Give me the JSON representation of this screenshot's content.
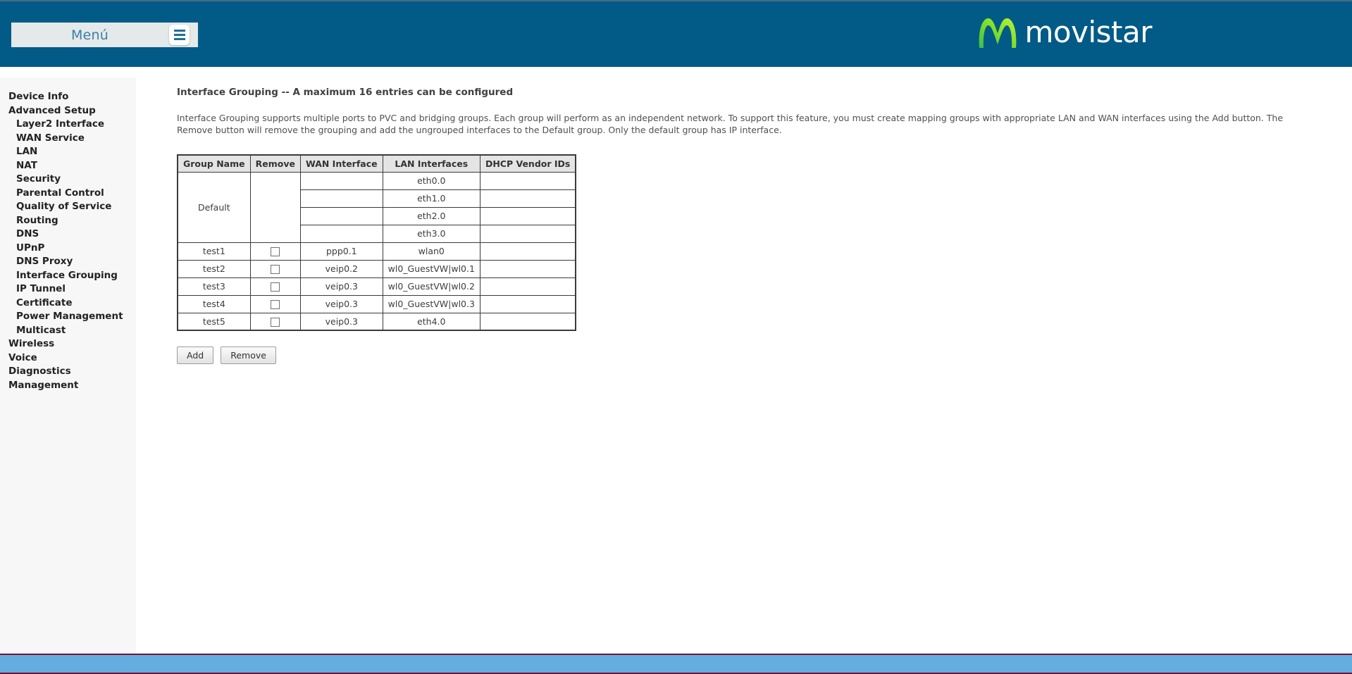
{
  "header": {
    "menu_label": "Menú",
    "menu_icon": "hamburger-icon",
    "brand": "movistar",
    "brand_mark_icon": "movistar-m-icon",
    "bar_color": "#025B87",
    "menu_box_color": "#e4e9ea",
    "menu_text_color": "#3c7fa8"
  },
  "sidebar": {
    "items": [
      {
        "label": "Device Info",
        "level": 0
      },
      {
        "label": "Advanced Setup",
        "level": 0
      },
      {
        "label": "Layer2 Interface",
        "level": 1
      },
      {
        "label": "WAN Service",
        "level": 1
      },
      {
        "label": "LAN",
        "level": 1
      },
      {
        "label": "NAT",
        "level": 1
      },
      {
        "label": "Security",
        "level": 1
      },
      {
        "label": "Parental Control",
        "level": 1
      },
      {
        "label": "Quality of Service",
        "level": 1
      },
      {
        "label": "Routing",
        "level": 1
      },
      {
        "label": "DNS",
        "level": 1
      },
      {
        "label": "UPnP",
        "level": 1
      },
      {
        "label": "DNS Proxy",
        "level": 1
      },
      {
        "label": "Interface Grouping",
        "level": 1
      },
      {
        "label": "IP Tunnel",
        "level": 1
      },
      {
        "label": "Certificate",
        "level": 1
      },
      {
        "label": "Power Management",
        "level": 1
      },
      {
        "label": "Multicast",
        "level": 1
      },
      {
        "label": "Wireless",
        "level": 0
      },
      {
        "label": "Voice",
        "level": 0
      },
      {
        "label": "Diagnostics",
        "level": 0
      },
      {
        "label": "Management",
        "level": 0
      }
    ],
    "background": "#f7f7f7"
  },
  "main": {
    "title": "Interface Grouping -- A maximum 16 entries can be configured",
    "description": "Interface Grouping supports multiple ports to PVC and bridging groups. Each group will perform as an independent network. To support this feature, you must create mapping groups with appropriate LAN and WAN interfaces using the Add button. The Remove button will remove the grouping and add the ungrouped interfaces to the Default group. Only the default group has IP interface.",
    "table": {
      "columns": [
        "Group Name",
        "Remove",
        "WAN Interface",
        "LAN Interfaces",
        "DHCP Vendor IDs"
      ],
      "default_group": {
        "name": "Default",
        "remove": "",
        "rows": [
          {
            "wan": "",
            "lan": "eth0.0",
            "dhcp": ""
          },
          {
            "wan": "",
            "lan": "eth1.0",
            "dhcp": ""
          },
          {
            "wan": "",
            "lan": "eth2.0",
            "dhcp": ""
          },
          {
            "wan": "",
            "lan": "eth3.0",
            "dhcp": ""
          }
        ]
      },
      "rows": [
        {
          "name": "test1",
          "remove_checked": false,
          "wan": "ppp0.1",
          "lan": "wlan0",
          "dhcp": ""
        },
        {
          "name": "test2",
          "remove_checked": false,
          "wan": "veip0.2",
          "lan": "wl0_GuestVW|wl0.1",
          "dhcp": ""
        },
        {
          "name": "test3",
          "remove_checked": false,
          "wan": "veip0.3",
          "lan": "wl0_GuestVW|wl0.2",
          "dhcp": ""
        },
        {
          "name": "test4",
          "remove_checked": false,
          "wan": "veip0.3",
          "lan": "wl0_GuestVW|wl0.3",
          "dhcp": ""
        },
        {
          "name": "test5",
          "remove_checked": false,
          "wan": "veip0.3",
          "lan": "eth4.0",
          "dhcp": ""
        }
      ]
    },
    "buttons": {
      "add": "Add",
      "remove": "Remove"
    }
  },
  "footer": {
    "bar_color": "#63aedf",
    "border_color": "#7a1033"
  }
}
